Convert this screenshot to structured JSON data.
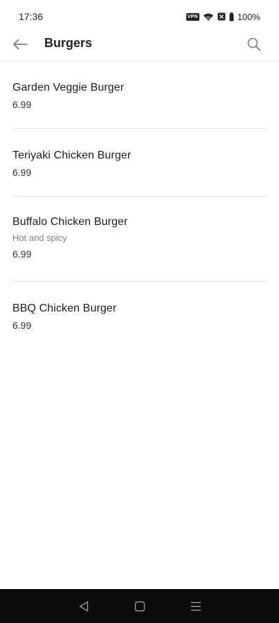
{
  "status_bar": {
    "time": "17:36",
    "vpn": "VPN",
    "battery": "100%"
  },
  "app_bar": {
    "title": "Burgers"
  },
  "items": [
    {
      "name": "Garden Veggie Burger",
      "description": "",
      "price": "6.99"
    },
    {
      "name": "Teriyaki Chicken Burger",
      "description": "",
      "price": "6.99"
    },
    {
      "name": "Buffalo Chicken Burger",
      "description": "Hot and spicy",
      "price": "6.99"
    },
    {
      "name": "BBQ Chicken Burger",
      "description": "",
      "price": "6.99"
    }
  ],
  "icons": {
    "back": "arrow-left-icon",
    "search": "search-icon",
    "nav_back": "triangle-back-icon",
    "nav_home": "square-home-icon",
    "nav_menu": "menu-lines-icon"
  },
  "colors": {
    "nav_bar": "#0b0b0b",
    "divider": "#e2e2e2",
    "secondary_text": "#808080"
  }
}
